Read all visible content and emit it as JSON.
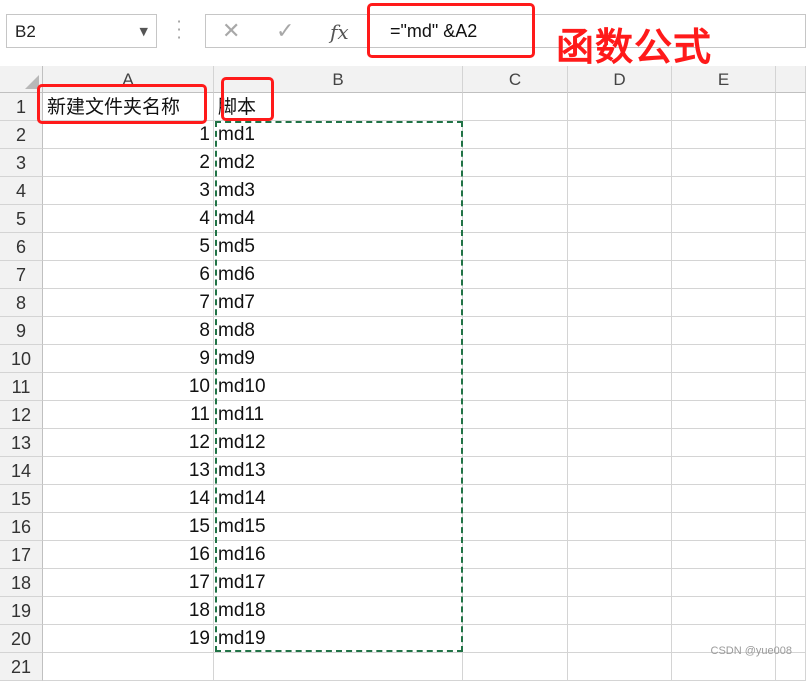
{
  "name_box": {
    "value": "B2"
  },
  "formula_bar": {
    "cancel_icon": "cancel-x-icon",
    "enter_icon": "checkmark-icon",
    "fx_label": "fx",
    "formula": "=\"md\" &A2"
  },
  "annotation": {
    "text": "函数公式",
    "color": "#ff1a1a"
  },
  "columns": [
    "A",
    "B",
    "C",
    "D",
    "E"
  ],
  "rows": [
    {
      "n": "1",
      "a": "新建文件夹名称",
      "b": "脚本"
    },
    {
      "n": "2",
      "a": "1",
      "b": "md1"
    },
    {
      "n": "3",
      "a": "2",
      "b": "md2"
    },
    {
      "n": "4",
      "a": "3",
      "b": "md3"
    },
    {
      "n": "5",
      "a": "4",
      "b": "md4"
    },
    {
      "n": "6",
      "a": "5",
      "b": "md5"
    },
    {
      "n": "7",
      "a": "6",
      "b": "md6"
    },
    {
      "n": "8",
      "a": "7",
      "b": "md7"
    },
    {
      "n": "9",
      "a": "8",
      "b": "md8"
    },
    {
      "n": "10",
      "a": "9",
      "b": "md9"
    },
    {
      "n": "11",
      "a": "10",
      "b": "md10"
    },
    {
      "n": "12",
      "a": "11",
      "b": "md11"
    },
    {
      "n": "13",
      "a": "12",
      "b": "md12"
    },
    {
      "n": "14",
      "a": "13",
      "b": "md13"
    },
    {
      "n": "15",
      "a": "14",
      "b": "md14"
    },
    {
      "n": "16",
      "a": "15",
      "b": "md15"
    },
    {
      "n": "17",
      "a": "16",
      "b": "md16"
    },
    {
      "n": "18",
      "a": "17",
      "b": "md17"
    },
    {
      "n": "19",
      "a": "18",
      "b": "md18"
    },
    {
      "n": "20",
      "a": "19",
      "b": "md19"
    },
    {
      "n": "21",
      "a": "",
      "b": ""
    }
  ],
  "watermark": "CSDN @yue008",
  "colors": {
    "highlight_red": "#ff1a1a",
    "copy_marquee_green": "#217346",
    "header_bg": "#f2f2f2"
  }
}
